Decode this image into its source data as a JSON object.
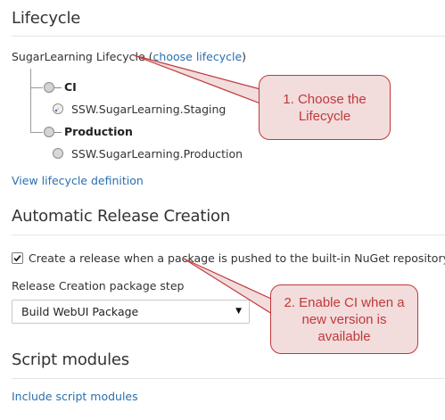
{
  "lifecycle": {
    "heading": "Lifecycle",
    "selected_name": "SugarLearning Lifecycle",
    "open_paren": "(",
    "choose_link": "choose lifecycle",
    "close_paren": ")",
    "phases": [
      {
        "name": "CI",
        "environments": [
          {
            "name": "SSW.SugarLearning.Staging",
            "icon": "deploy-in-progress-icon"
          }
        ]
      },
      {
        "name": "Production",
        "environments": [
          {
            "name": "SSW.SugarLearning.Production",
            "icon": "environment-circle-icon"
          }
        ]
      }
    ],
    "view_link": "View lifecycle definition"
  },
  "release_creation": {
    "heading": "Automatic Release Creation",
    "checkbox_label": "Create a release when a package is pushed to the built-in NuGet repository",
    "checkbox_checked": true,
    "step_label": "Release Creation package step",
    "step_selected": "Build WebUI Package"
  },
  "script_modules": {
    "heading": "Script modules",
    "include_link": "Include script modules"
  },
  "callouts": [
    {
      "text": "1. Choose the Lifecycle"
    },
    {
      "text": "2. Enable CI when a new version is available"
    }
  ],
  "colors": {
    "link": "#2a6fb0",
    "callout_border": "#c0393b",
    "callout_fill": "#f2dcdc",
    "divider": "#e5e5e5"
  }
}
